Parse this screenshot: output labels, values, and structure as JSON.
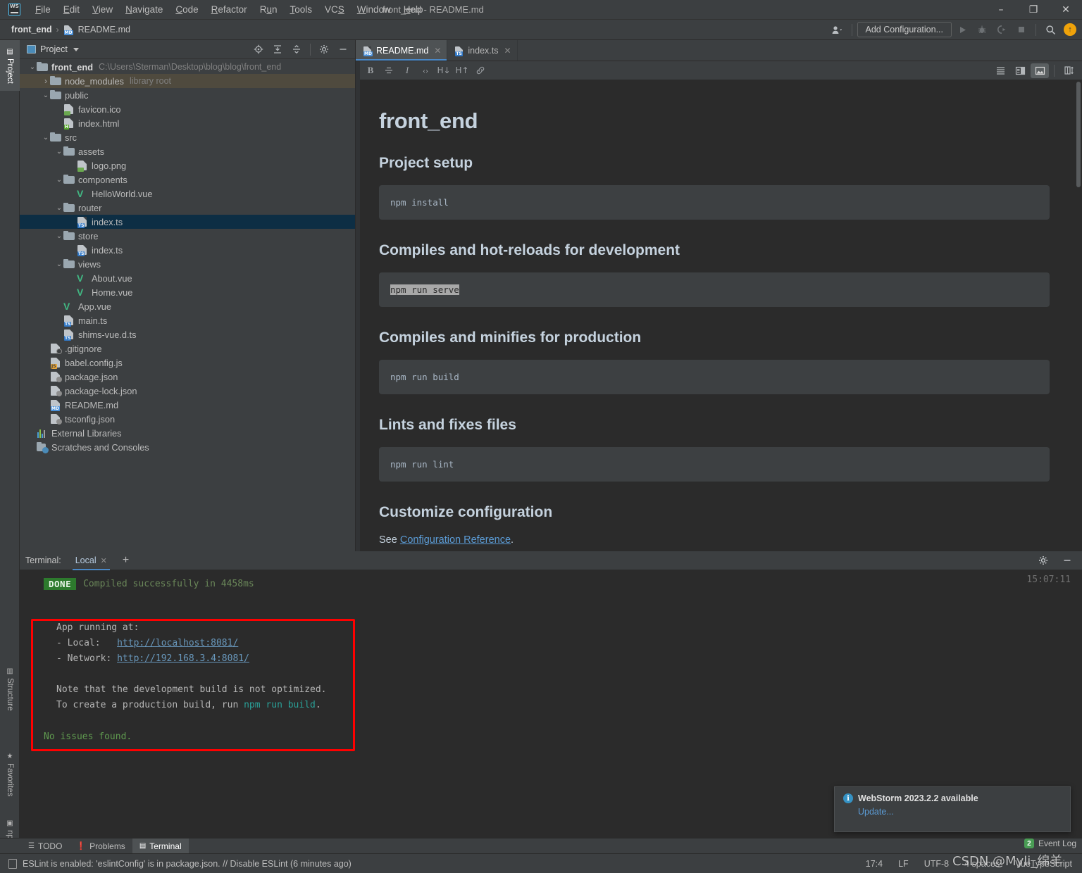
{
  "window": {
    "title": "front_end - README.md",
    "app_icon": "webstorm-logo",
    "minimize": "–",
    "maximize": "❐",
    "close": "✕"
  },
  "menubar": [
    {
      "label": "File"
    },
    {
      "label": "Edit"
    },
    {
      "label": "View"
    },
    {
      "label": "Navigate"
    },
    {
      "label": "Code"
    },
    {
      "label": "Refactor"
    },
    {
      "label": "Run"
    },
    {
      "label": "Tools"
    },
    {
      "label": "VCS"
    },
    {
      "label": "Window"
    },
    {
      "label": "Help"
    }
  ],
  "breadcrumb": {
    "project": "front_end",
    "separator": "›",
    "file": "README.md"
  },
  "navbar_right": {
    "add_configuration": "Add Configuration...",
    "run_icon": "run-icon",
    "debug_icon": "debug-icon",
    "coverage_icon": "coverage-icon",
    "stop_icon": "stop-icon",
    "search_icon": "search-icon",
    "update_icon": "update-available-icon",
    "profile_icon": "user-profile-icon"
  },
  "tool_strip": {
    "top": [
      {
        "label": "Project",
        "icon": "project-icon",
        "active": true
      }
    ],
    "bottom": [
      {
        "label": "Structure",
        "icon": "structure-icon"
      },
      {
        "label": "Favorites",
        "icon": "star-icon"
      },
      {
        "label": "npm",
        "icon": "npm-icon"
      }
    ]
  },
  "project_panel": {
    "title": "Project",
    "actions": [
      "locate-icon",
      "expand-all-icon",
      "collapse-all-icon",
      "settings-icon",
      "hide-icon"
    ],
    "tree": [
      {
        "depth": 0,
        "arrow": "expanded",
        "icon": "folder",
        "label": "front_end",
        "bold": true,
        "muted": "C:\\Users\\Sterman\\Desktop\\blog\\blog\\front_end"
      },
      {
        "depth": 1,
        "arrow": "collapsed",
        "icon": "folder",
        "label": "node_modules",
        "muted": "library root",
        "highlight": "library"
      },
      {
        "depth": 1,
        "arrow": "expanded",
        "icon": "folder",
        "label": "public"
      },
      {
        "depth": 2,
        "arrow": "none",
        "icon": "file-image",
        "label": "favicon.ico"
      },
      {
        "depth": 2,
        "arrow": "none",
        "icon": "file-html",
        "label": "index.html"
      },
      {
        "depth": 1,
        "arrow": "expanded",
        "icon": "folder",
        "label": "src"
      },
      {
        "depth": 2,
        "arrow": "expanded",
        "icon": "folder",
        "label": "assets"
      },
      {
        "depth": 3,
        "arrow": "none",
        "icon": "file-image",
        "label": "logo.png"
      },
      {
        "depth": 2,
        "arrow": "expanded",
        "icon": "folder",
        "label": "components"
      },
      {
        "depth": 3,
        "arrow": "none",
        "icon": "file-vue",
        "label": "HelloWorld.vue"
      },
      {
        "depth": 2,
        "arrow": "expanded",
        "icon": "folder",
        "label": "router"
      },
      {
        "depth": 3,
        "arrow": "none",
        "icon": "file-ts",
        "label": "index.ts",
        "selected": true
      },
      {
        "depth": 2,
        "arrow": "expanded",
        "icon": "folder",
        "label": "store"
      },
      {
        "depth": 3,
        "arrow": "none",
        "icon": "file-ts",
        "label": "index.ts"
      },
      {
        "depth": 2,
        "arrow": "expanded",
        "icon": "folder",
        "label": "views"
      },
      {
        "depth": 3,
        "arrow": "none",
        "icon": "file-vue",
        "label": "About.vue"
      },
      {
        "depth": 3,
        "arrow": "none",
        "icon": "file-vue",
        "label": "Home.vue"
      },
      {
        "depth": 2,
        "arrow": "none",
        "icon": "file-vue",
        "label": "App.vue"
      },
      {
        "depth": 2,
        "arrow": "none",
        "icon": "file-ts",
        "label": "main.ts"
      },
      {
        "depth": 2,
        "arrow": "none",
        "icon": "file-ts",
        "label": "shims-vue.d.ts"
      },
      {
        "depth": 1,
        "arrow": "none",
        "icon": "file-gitignore",
        "label": ".gitignore"
      },
      {
        "depth": 1,
        "arrow": "none",
        "icon": "file-js",
        "label": "babel.config.js"
      },
      {
        "depth": 1,
        "arrow": "none",
        "icon": "file-json",
        "label": "package.json"
      },
      {
        "depth": 1,
        "arrow": "none",
        "icon": "file-json",
        "label": "package-lock.json"
      },
      {
        "depth": 1,
        "arrow": "none",
        "icon": "file-md",
        "label": "README.md"
      },
      {
        "depth": 1,
        "arrow": "none",
        "icon": "file-json",
        "label": "tsconfig.json"
      },
      {
        "depth": 0,
        "arrow": "none",
        "icon": "external-libraries",
        "label": "External Libraries"
      },
      {
        "depth": 0,
        "arrow": "none",
        "icon": "scratches",
        "label": "Scratches and Consoles"
      }
    ]
  },
  "editor": {
    "tabs": [
      {
        "label": "README.md",
        "icon": "file-md",
        "active": true,
        "close": "✕"
      },
      {
        "label": "index.ts",
        "icon": "file-ts",
        "active": false,
        "close": "✕"
      }
    ],
    "md_toolbar": [
      {
        "name": "bold-icon",
        "glyph": "B"
      },
      {
        "name": "strikethrough-icon",
        "glyph": "S"
      },
      {
        "name": "italic-icon",
        "glyph": "I"
      },
      {
        "name": "code-icon",
        "glyph": "‹›"
      },
      {
        "name": "heading-down-icon",
        "glyph": "H↓"
      },
      {
        "name": "heading-up-icon",
        "glyph": "H↑"
      },
      {
        "name": "link-icon",
        "glyph": "🔗"
      }
    ],
    "md_toolbar_right": [
      {
        "name": "editor-only-icon",
        "glyph": "≣"
      },
      {
        "name": "editor-and-preview-icon",
        "glyph": "◨"
      },
      {
        "name": "preview-only-icon",
        "glyph": "▣",
        "pressed": true
      },
      {
        "name": "auto-scroll-preview-icon",
        "glyph": "◫"
      }
    ],
    "preview": {
      "h1": "front_end",
      "sections": [
        {
          "heading": "Project setup",
          "code": "npm install",
          "selected": false
        },
        {
          "heading": "Compiles and hot-reloads for development",
          "code": "npm run serve",
          "selected": true
        },
        {
          "heading": "Compiles and minifies for production",
          "code": "npm run build",
          "selected": false
        },
        {
          "heading": "Lints and fixes files",
          "code": "npm run lint",
          "selected": false
        }
      ],
      "customize_heading": "Customize configuration",
      "see_prefix": "See ",
      "see_link": "Configuration Reference",
      "see_suffix": "."
    }
  },
  "terminal": {
    "label": "Terminal:",
    "tab": "Local",
    "tab_close": "✕",
    "add": "+",
    "settings_icon": "gear-icon",
    "hide_icon": "minimize-icon",
    "timestamp": "15:07:11",
    "done_badge": "DONE",
    "compiled_message": "Compiled successfully in 4458ms",
    "app_running": "App running at:",
    "local_label": "- Local:   ",
    "local_url": "http://localhost:8081/",
    "network_label": "- Network: ",
    "network_url": "http://192.168.3.4:8081/",
    "note_line1": "Note that the development build is not optimized.",
    "note_line2_pre": "To create a production build, run ",
    "note_line2_cmd": "npm run build",
    "note_line2_post": ".",
    "no_issues": "No issues found."
  },
  "notification": {
    "icon": "info-icon",
    "title": "WebStorm 2023.2.2 available",
    "action": "Update..."
  },
  "bottom_tabs": [
    {
      "label": "TODO",
      "icon": "todo-icon",
      "active": false
    },
    {
      "label": "Problems",
      "icon": "problems-icon",
      "active": false
    },
    {
      "label": "Terminal",
      "icon": "terminal-icon",
      "active": true
    }
  ],
  "event_log": {
    "count": "2",
    "label": "Event Log"
  },
  "statusbar": {
    "message": "ESLint is enabled: 'eslintConfig' is in package.json. // Disable ESLint (6 minutes ago)",
    "caret": "17:4",
    "line_sep": "LF",
    "encoding": "UTF-8",
    "indent": "4 spaces",
    "language": "VueTypeScript"
  },
  "watermark": "CSDN @Myli_绵羊",
  "colors": {
    "accent_blue": "#4a88c7",
    "selection": "#0d2e44",
    "library_root": "#4f4a3e",
    "terminal_green": "#6a8759",
    "link": "#6897bb",
    "annotation_red": "#ff0000",
    "update_orange": "#f0a30a"
  }
}
